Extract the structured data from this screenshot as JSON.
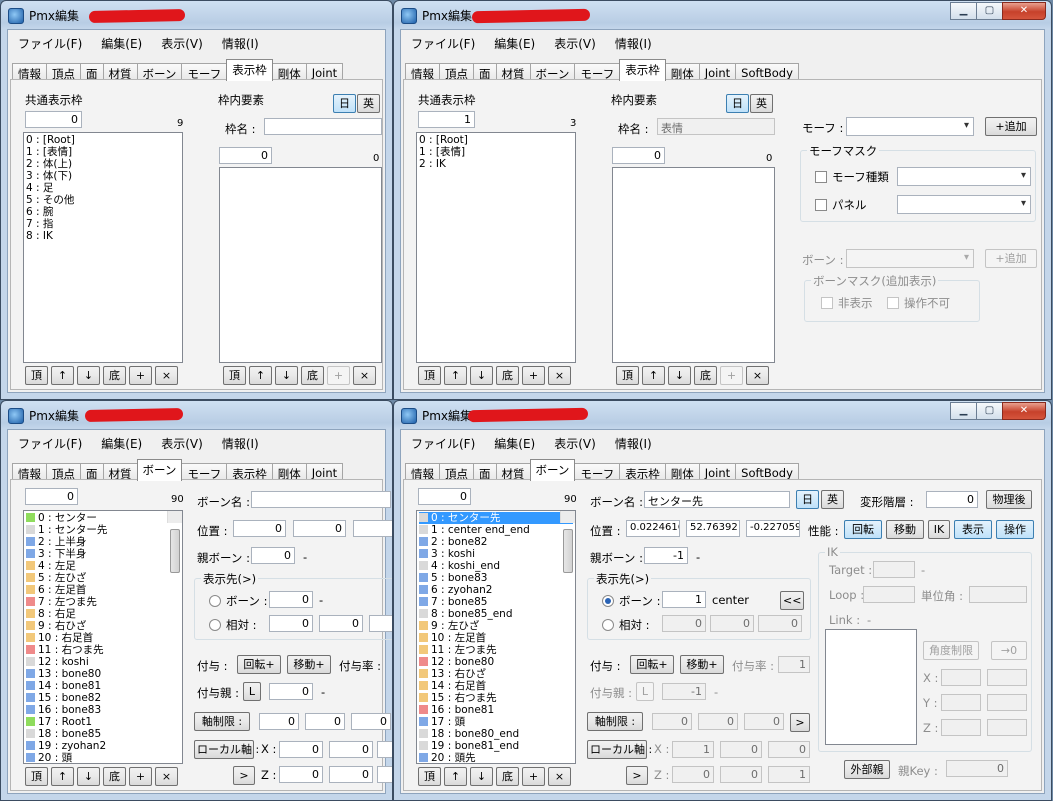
{
  "app_title": "Pmx編集",
  "menu": [
    "ファイル(F)",
    "編集(E)",
    "表示(V)",
    "情報(I)"
  ],
  "tabs": [
    "情報",
    "頂点",
    "面",
    "材質",
    "ボーン",
    "モーフ",
    "表示枠",
    "剛体",
    "Joint",
    "SoftBody"
  ],
  "caption_buttons": [
    "minimize-icon",
    "maximize-icon",
    "close-icon"
  ],
  "w1": {
    "common_label": "共通表示枠",
    "common_value": "0",
    "common_count": "9",
    "frames": [
      "0 : [Root]",
      "1 : [表情]",
      "2 : 体(上)",
      "3 : 体(下)",
      "4 : 足",
      "5 : その他",
      "6 : 腕",
      "7 : 指",
      "8 : IK"
    ],
    "inner_label": "枠内要素",
    "lang_ja": "日",
    "lang_en": "英",
    "name_label": "枠名 :",
    "name_value": "",
    "inner_value": "0",
    "inner_count": "0",
    "btns": [
      "頂",
      "↑",
      "↓",
      "底",
      "+",
      "×"
    ]
  },
  "w2": {
    "common_label": "共通表示枠",
    "common_value": "1",
    "common_count": "3",
    "frames": [
      "0 : [Root]",
      "1 : [表情]",
      "2 : IK"
    ],
    "inner_label": "枠内要素",
    "lang_ja": "日",
    "lang_en": "英",
    "name_label": "枠名 :",
    "name_value": "表情",
    "inner_value": "0",
    "inner_count": "0",
    "morph_label": "モーフ :",
    "add_label": "+追加",
    "morph_mask": "モーフマスク",
    "morph_type": "モーフ種類",
    "panel": "パネル",
    "bone_label": "ボーン :",
    "bone_add": "+追加",
    "bone_mask": "ボーンマスク(追加表示)",
    "hide": "非表示",
    "lock": "操作不可",
    "btns": [
      "頂",
      "↑",
      "↓",
      "底",
      "+",
      "×"
    ]
  },
  "w3": {
    "value": "0",
    "count": "90",
    "bones": [
      {
        "t": "0 : センター",
        "c": "#8fdc5d"
      },
      {
        "t": "1 : センター先",
        "c": "#d9d9d9"
      },
      {
        "t": "2 : 上半身",
        "c": "#7fa8e6"
      },
      {
        "t": "3 : 下半身",
        "c": "#7fa8e6"
      },
      {
        "t": "4 : 左足",
        "c": "#f2c87a"
      },
      {
        "t": "5 : 左ひざ",
        "c": "#f2c87a"
      },
      {
        "t": "6 : 左足首",
        "c": "#f2c87a"
      },
      {
        "t": "7 : 左つま先",
        "c": "#ef8a8a"
      },
      {
        "t": "8 : 右足",
        "c": "#f2c87a"
      },
      {
        "t": "9 : 右ひざ",
        "c": "#f2c87a"
      },
      {
        "t": "10 : 右足首",
        "c": "#f2c87a"
      },
      {
        "t": "11 : 右つま先",
        "c": "#ef8a8a"
      },
      {
        "t": "12 : koshi",
        "c": "#d9d9d9"
      },
      {
        "t": "13 : bone80",
        "c": "#7fa8e6"
      },
      {
        "t": "14 : bone81",
        "c": "#7fa8e6"
      },
      {
        "t": "15 : bone82",
        "c": "#7fa8e6"
      },
      {
        "t": "16 : bone83",
        "c": "#7fa8e6"
      },
      {
        "t": "17 : Root1",
        "c": "#8fdc5d"
      },
      {
        "t": "18 : bone85",
        "c": "#d9d9d9"
      },
      {
        "t": "19 : zyohan2",
        "c": "#7fa8e6"
      },
      {
        "t": "20 : 頭",
        "c": "#7fa8e6"
      }
    ],
    "bone_name": "ボーン名 :",
    "pos": "位置 :",
    "pos_vals": [
      "0",
      "0",
      ""
    ],
    "parent": "親ボーン :",
    "parent_val": "0",
    "dash": "-",
    "target": "表示先(>)",
    "bone_r": "ボーン :",
    "bone_r_val": "0",
    "rel": "相対 :",
    "rel_vals": [
      "0",
      "0",
      ""
    ],
    "grant": "付与 :",
    "rot": "回転+",
    "mov": "移動+",
    "rate": "付与率 :",
    "grant_parent": "付与親 :",
    "L": "L",
    "gp_val": "0",
    "axis": "軸制限 :",
    "axis_vals": [
      "0",
      "0",
      "0"
    ],
    "local": "ローカル軸 :",
    "X": "X :",
    "Z": "Z :",
    "lx": [
      "0",
      "0",
      ""
    ],
    "lz": [
      "0",
      "0",
      ""
    ],
    "arrow": ">",
    "btns": [
      "頂",
      "↑",
      "↓",
      "底",
      "+",
      "×"
    ]
  },
  "w4": {
    "value": "0",
    "count": "90",
    "bones": [
      {
        "t": "0 : センター先",
        "c": "#d9d9d9"
      },
      {
        "t": "1 : center end_end",
        "c": "#d9d9d9"
      },
      {
        "t": "2 : bone82",
        "c": "#7fa8e6"
      },
      {
        "t": "3 : koshi",
        "c": "#7fa8e6"
      },
      {
        "t": "4 : koshi_end",
        "c": "#d9d9d9"
      },
      {
        "t": "5 : bone83",
        "c": "#7fa8e6"
      },
      {
        "t": "6 : zyohan2",
        "c": "#7fa8e6"
      },
      {
        "t": "7 : bone85",
        "c": "#7fa8e6"
      },
      {
        "t": "8 : bone85_end",
        "c": "#d9d9d9"
      },
      {
        "t": "9 : 左ひざ",
        "c": "#f2c87a"
      },
      {
        "t": "10 : 左足首",
        "c": "#f2c87a"
      },
      {
        "t": "11 : 左つま先",
        "c": "#f2c87a"
      },
      {
        "t": "12 : bone80",
        "c": "#ef8a8a"
      },
      {
        "t": "13 : 右ひざ",
        "c": "#f2c87a"
      },
      {
        "t": "14 : 右足首",
        "c": "#f2c87a"
      },
      {
        "t": "15 : 右つま先",
        "c": "#f2c87a"
      },
      {
        "t": "16 : bone81",
        "c": "#ef8a8a"
      },
      {
        "t": "17 : 頭",
        "c": "#7fa8e6"
      },
      {
        "t": "18 : bone80_end",
        "c": "#d9d9d9"
      },
      {
        "t": "19 : bone81_end",
        "c": "#d9d9d9"
      },
      {
        "t": "20 : 頭先",
        "c": "#7fa8e6"
      }
    ],
    "bone_name": "ボーン名 :",
    "bone_name_val": "センター先",
    "lang_ja": "日",
    "lang_en": "英",
    "deform": "変形階層 :",
    "deform_val": "0",
    "after_phys": "物理後",
    "pos": "位置 :",
    "pos_vals": [
      "0.0224616",
      "52.76392",
      "-0.227059"
    ],
    "perf": "性能 :",
    "perf_btns": [
      "回転",
      "移動",
      "IK",
      "表示",
      "操作"
    ],
    "parent": "親ボーン :",
    "parent_val": "-1",
    "dash": "-",
    "target": "表示先(>)",
    "bone_r": "ボーン :",
    "bone_r_val": "1",
    "bone_r_name": "center",
    "back": "<<",
    "rel": "相対 :",
    "rel_vals": [
      "0",
      "0",
      "0"
    ],
    "grant": "付与 :",
    "rot": "回転+",
    "mov": "移動+",
    "rate": "付与率 :",
    "rate_val": "1",
    "grant_parent": "付与親 :",
    "L": "L",
    "gp_val": "-1",
    "axis": "軸制限 :",
    "axis_vals": [
      "0",
      "0",
      "0"
    ],
    "arrow": ">",
    "local": "ローカル軸 :",
    "X": "X :",
    "Z": "Z :",
    "lx": [
      "1",
      "0",
      "0"
    ],
    "lz": [
      "0",
      "0",
      "1"
    ],
    "ik": "IK",
    "ik_target": "Target :",
    "ik_loop": "Loop :",
    "ik_unit": "単位角 :",
    "ik_link": "Link :",
    "ik_link_val": "-",
    "angle_limit": "角度制限",
    "to_zero": "→0",
    "xyz": [
      "X :",
      "Y :",
      "Z :"
    ],
    "ext_parent": "外部親",
    "parent_key": "親Key :",
    "parent_key_val": "0",
    "btns": [
      "頂",
      "↑",
      "↓",
      "底",
      "+",
      "×"
    ]
  }
}
